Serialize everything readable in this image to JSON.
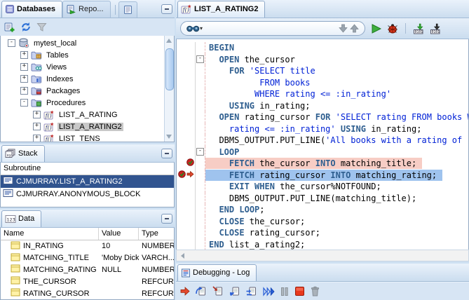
{
  "sidebar": {
    "tabs": [
      {
        "label": "Databases",
        "icon": "databases-tab-icon",
        "active": true
      },
      {
        "label": "Repo...",
        "icon": "reports-tab-icon",
        "active": false
      },
      {
        "label": "",
        "icon": "page-icon",
        "active": false
      }
    ],
    "toolbar": [
      {
        "name": "add-connection-button",
        "icon": "new-connection-icon"
      },
      {
        "name": "refresh-button",
        "icon": "refresh-icon"
      },
      {
        "name": "filter-button",
        "icon": "filter-icon"
      }
    ],
    "tree": [
      {
        "label": "mytest_local",
        "icon": "database-icon",
        "expander": "minus",
        "depth": 0,
        "selected": false
      },
      {
        "label": "Tables",
        "icon": "folder-tables-icon",
        "expander": "plus",
        "depth": 1,
        "selected": false
      },
      {
        "label": "Views",
        "icon": "folder-views-icon",
        "expander": "plus",
        "depth": 1,
        "selected": false
      },
      {
        "label": "Indexes",
        "icon": "folder-indexes-icon",
        "expander": "plus",
        "depth": 1,
        "selected": false
      },
      {
        "label": "Packages",
        "icon": "folder-packages-icon",
        "expander": "plus",
        "depth": 1,
        "selected": false
      },
      {
        "label": "Procedures",
        "icon": "folder-procedures-icon",
        "expander": "minus",
        "depth": 1,
        "selected": false
      },
      {
        "label": "LIST_A_RATING",
        "icon": "procedure-icon",
        "expander": "plus",
        "depth": 2,
        "selected": false
      },
      {
        "label": "LIST_A_RATING2",
        "icon": "procedure-icon",
        "expander": "plus",
        "depth": 2,
        "selected": true
      },
      {
        "label": "LIST_TENS",
        "icon": "procedure-icon",
        "expander": "plus",
        "depth": 2,
        "selected": false
      }
    ]
  },
  "stack": {
    "tab_label": "Stack",
    "column_header": "Subroutine",
    "rows": [
      {
        "label": "CJMURRAY.LIST_A_RATING2",
        "selected": true
      },
      {
        "label": "CJMURRAY.ANONYMOUS_BLOCK",
        "selected": false
      }
    ]
  },
  "data_panel": {
    "tab_label": "Data",
    "columns": [
      "Name",
      "Value",
      "Type"
    ],
    "rows": [
      {
        "name": "IN_RATING",
        "value": "10",
        "type": "NUMBER"
      },
      {
        "name": "MATCHING_TITLE",
        "value": "'Moby Dick'",
        "type": "VARCH..."
      },
      {
        "name": "MATCHING_RATING",
        "value": "NULL",
        "type": "NUMBER"
      },
      {
        "name": "THE_CURSOR",
        "value": "",
        "type": "REFCUR..."
      },
      {
        "name": "RATING_CURSOR",
        "value": "",
        "type": "REFCUR..."
      }
    ]
  },
  "editor": {
    "tab_label": "LIST_A_RATING2",
    "search_group": [
      {
        "name": "search-dropdown",
        "icon": "search-icon",
        "caret": true
      },
      {
        "name": "find-previous-button",
        "icon": "arrow-down-icon"
      },
      {
        "name": "find-next-button",
        "icon": "arrow-up-icon"
      }
    ],
    "actions": [
      {
        "name": "run-button",
        "icon": "run-icon"
      },
      {
        "name": "debug-button",
        "icon": "debug-icon"
      },
      {
        "name": "separator"
      },
      {
        "name": "compile-for-debug-button",
        "icon": "compile-debug-icon"
      },
      {
        "name": "compile-button",
        "icon": "compile-icon"
      }
    ],
    "lines": [
      {
        "tokens": [
          [
            "k",
            "BEGIN"
          ]
        ]
      },
      {
        "fold": "minus",
        "tokens": [
          [
            "p",
            "  "
          ],
          [
            "k",
            "OPEN"
          ],
          [
            "p",
            " the_cursor"
          ]
        ]
      },
      {
        "tokens": [
          [
            "p",
            "    "
          ],
          [
            "k",
            "FOR"
          ],
          [
            "p",
            " "
          ],
          [
            "s",
            "'SELECT title"
          ]
        ]
      },
      {
        "tokens": [
          [
            "s",
            "          FROM books"
          ]
        ]
      },
      {
        "tokens": [
          [
            "s",
            "         WHERE rating <= :in_rating'"
          ]
        ]
      },
      {
        "tokens": [
          [
            "p",
            "    "
          ],
          [
            "k",
            "USING"
          ],
          [
            "p",
            " in_rating;"
          ]
        ]
      },
      {
        "tokens": [
          [
            "p",
            "  "
          ],
          [
            "k",
            "OPEN"
          ],
          [
            "p",
            " rating_cursor "
          ],
          [
            "k",
            "FOR"
          ],
          [
            "p",
            " "
          ],
          [
            "s",
            "'SELECT rating FROM books WHERE"
          ]
        ]
      },
      {
        "tokens": [
          [
            "s",
            "    rating <= :in_rating'"
          ],
          [
            "p",
            " "
          ],
          [
            "k",
            "USING"
          ],
          [
            "p",
            " in_rating;"
          ]
        ]
      },
      {
        "tokens": [
          [
            "p",
            "  DBMS_OUTPUT.PUT_LINE("
          ],
          [
            "s",
            "'All books with a rating of ' "
          ]
        ]
      },
      {
        "fold": "minus",
        "tokens": [
          [
            "p",
            "  "
          ],
          [
            "k",
            "LOOP"
          ]
        ]
      },
      {
        "gutter": "breakpoint",
        "highlight": "breakpoint",
        "tokens": [
          [
            "p",
            "    "
          ],
          [
            "k",
            "FETCH"
          ],
          [
            "p",
            " the_cursor "
          ],
          [
            "k",
            "INTO"
          ],
          [
            "p",
            " matching_title;"
          ]
        ]
      },
      {
        "gutter": "breakpoint-current",
        "highlight": "current",
        "tokens": [
          [
            "p",
            "    "
          ],
          [
            "k",
            "FETCH"
          ],
          [
            "p",
            " rating_cursor "
          ],
          [
            "k",
            "INTO"
          ],
          [
            "p",
            " matching_rating;"
          ]
        ]
      },
      {
        "tokens": [
          [
            "p",
            "    "
          ],
          [
            "k",
            "EXIT"
          ],
          [
            "p",
            " "
          ],
          [
            "k",
            "WHEN"
          ],
          [
            "p",
            " the_cursor%NOTFOUND;"
          ]
        ]
      },
      {
        "tokens": [
          [
            "p",
            "    DBMS_OUTPUT.PUT_LINE(matching_title);"
          ]
        ]
      },
      {
        "tokens": [
          [
            "p",
            "  "
          ],
          [
            "k",
            "END"
          ],
          [
            "p",
            " "
          ],
          [
            "k",
            "LOOP"
          ],
          [
            "p",
            ";"
          ]
        ]
      },
      {
        "tokens": [
          [
            "p",
            "  "
          ],
          [
            "k",
            "CLOSE"
          ],
          [
            "p",
            " the_cursor;"
          ]
        ]
      },
      {
        "tokens": [
          [
            "p",
            "  "
          ],
          [
            "k",
            "CLOSE"
          ],
          [
            "p",
            " rating_cursor;"
          ]
        ]
      },
      {
        "tokens": [
          [
            "k",
            "END"
          ],
          [
            "p",
            " list_a_rating2;"
          ]
        ]
      }
    ]
  },
  "log": {
    "tab_label": "Debugging - Log",
    "toolbar": [
      {
        "name": "find-execution-point-button",
        "icon": "find-execution-icon"
      },
      {
        "name": "step-over-button",
        "icon": "step-over-icon"
      },
      {
        "name": "step-into-button",
        "icon": "step-into-icon"
      },
      {
        "name": "step-out-button",
        "icon": "step-out-icon"
      },
      {
        "name": "step-to-end-button",
        "icon": "step-to-end-icon"
      },
      {
        "name": "resume-button",
        "icon": "resume-icon"
      },
      {
        "name": "pause-button",
        "icon": "pause-icon"
      },
      {
        "name": "terminate-button",
        "icon": "terminate-icon"
      },
      {
        "name": "clear-log-button",
        "icon": "trash-icon"
      }
    ]
  },
  "colors": {
    "selection": "#31548F",
    "tree_selection": "#C8C8C8",
    "breakpoint_line": "#F7CDC5",
    "current_line": "#9FC3EE",
    "keyword": "#2E5E8F",
    "string": "#0021D6"
  }
}
